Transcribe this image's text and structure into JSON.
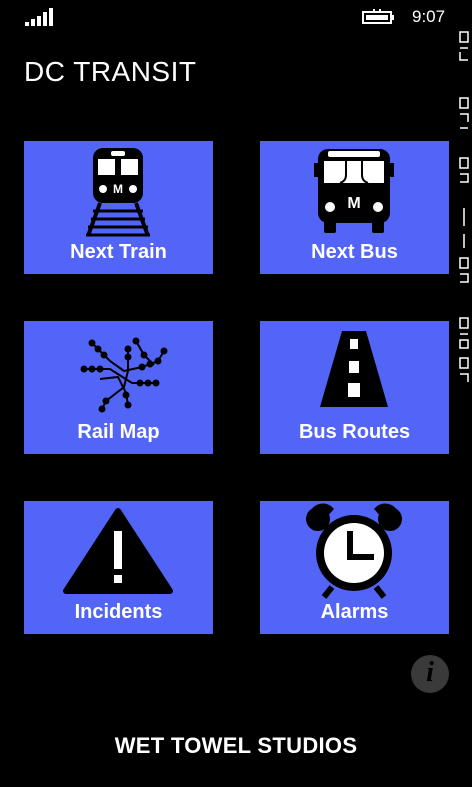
{
  "status_bar": {
    "time": "9:07",
    "signal_icon": "signal-bars-icon",
    "battery_icon": "battery-charging-icon"
  },
  "app": {
    "title": "DC TRANSIT"
  },
  "tiles": [
    {
      "label": "Next Train",
      "icon": "metro-train-icon"
    },
    {
      "label": "Next Bus",
      "icon": "metro-bus-icon"
    },
    {
      "label": "Rail Map",
      "icon": "rail-map-icon"
    },
    {
      "label": "Bus Routes",
      "icon": "road-icon"
    },
    {
      "label": "Incidents",
      "icon": "warning-icon"
    },
    {
      "label": "Alarms",
      "icon": "alarm-clock-icon"
    }
  ],
  "info_button": {
    "glyph": "i",
    "icon": "info-icon"
  },
  "footer": {
    "text": "WET TOWEL STUDIOS"
  },
  "colors": {
    "background": "#000000",
    "tile": "#5365f7",
    "text": "#ffffff"
  }
}
